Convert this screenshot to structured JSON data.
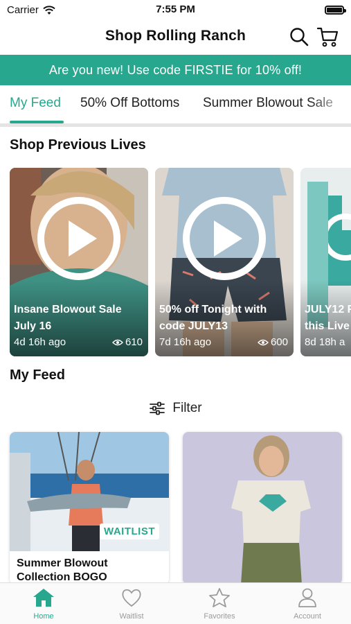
{
  "status": {
    "carrier": "Carrier",
    "time": "7:55 PM"
  },
  "header": {
    "title": "Shop Rolling Ranch"
  },
  "promo": {
    "text": "Are you new! Use code FIRSTIE for 10% off!"
  },
  "tabs": [
    {
      "label": "My Feed",
      "active": true
    },
    {
      "label": "50% Off Bottoms",
      "active": false
    },
    {
      "label": "Summer Blowout Sale",
      "active": false
    }
  ],
  "lives_section": {
    "title": "Shop Previous Lives",
    "cards": [
      {
        "title_line1": "Insane Blowout Sale",
        "title_line2": "July 16",
        "ago": "4d 16h ago",
        "views": "610"
      },
      {
        "title_line1": "50% off Tonight with",
        "title_line2": "code JULY13",
        "ago": "7d 16h ago",
        "views": "600"
      },
      {
        "title_line1": "JULY12 F",
        "title_line2": "this Live",
        "ago": "8d 18h a",
        "views": ""
      }
    ]
  },
  "feed": {
    "title": "My Feed",
    "filter_label": "Filter",
    "products": [
      {
        "name_line1": "Summer Blowout",
        "name_line2": "Collection BOGO",
        "badge": "WAITLIST"
      },
      {
        "name_line1": "",
        "name_line2": "",
        "badge": ""
      }
    ]
  },
  "tabbar": [
    {
      "label": "Home",
      "icon": "home-icon",
      "active": true
    },
    {
      "label": "Waitlist",
      "icon": "heart-icon",
      "active": false
    },
    {
      "label": "Favorites",
      "icon": "star-icon",
      "active": false
    },
    {
      "label": "Account",
      "icon": "person-icon",
      "active": false
    }
  ],
  "colors": {
    "accent": "#27a88e",
    "inactive": "#9a9a9a"
  }
}
